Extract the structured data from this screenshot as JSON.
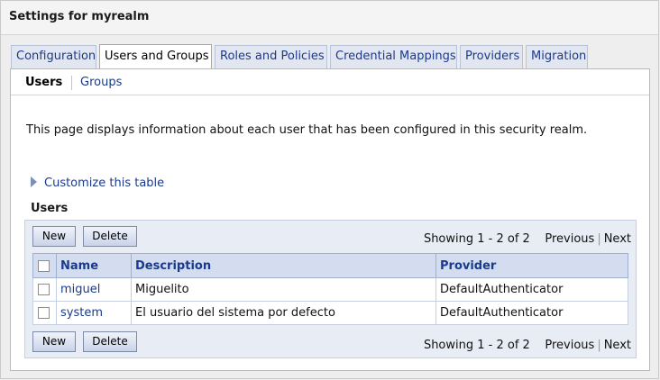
{
  "window": {
    "title": "Settings for myrealm"
  },
  "tabs": [
    {
      "label": "Configuration"
    },
    {
      "label": "Users and Groups"
    },
    {
      "label": "Roles and Policies"
    },
    {
      "label": "Credential Mappings"
    },
    {
      "label": "Providers"
    },
    {
      "label": "Migration"
    }
  ],
  "active_tab": "Users and Groups",
  "subtabs": {
    "active": "Users",
    "other": "Groups"
  },
  "description": "This page displays information about each user that has been configured in this security realm.",
  "customize_link": "Customize this table",
  "section_title": "Users",
  "toolbar": {
    "new_label": "New",
    "delete_label": "Delete"
  },
  "pagination": {
    "showing": "Showing 1 - 2 of 2",
    "previous": "Previous",
    "next": "Next"
  },
  "table": {
    "columns": [
      "Name",
      "Description",
      "Provider"
    ],
    "rows": [
      {
        "name": "miguel",
        "description": "Miguelito",
        "provider": "DefaultAuthenticator"
      },
      {
        "name": "system",
        "description": "El usuario del sistema por defecto",
        "provider": "DefaultAuthenticator"
      }
    ]
  },
  "colors": {
    "link": "#1b3a8c",
    "header_bg": "#d3ddef",
    "tab_bg": "#e1e6f1"
  }
}
